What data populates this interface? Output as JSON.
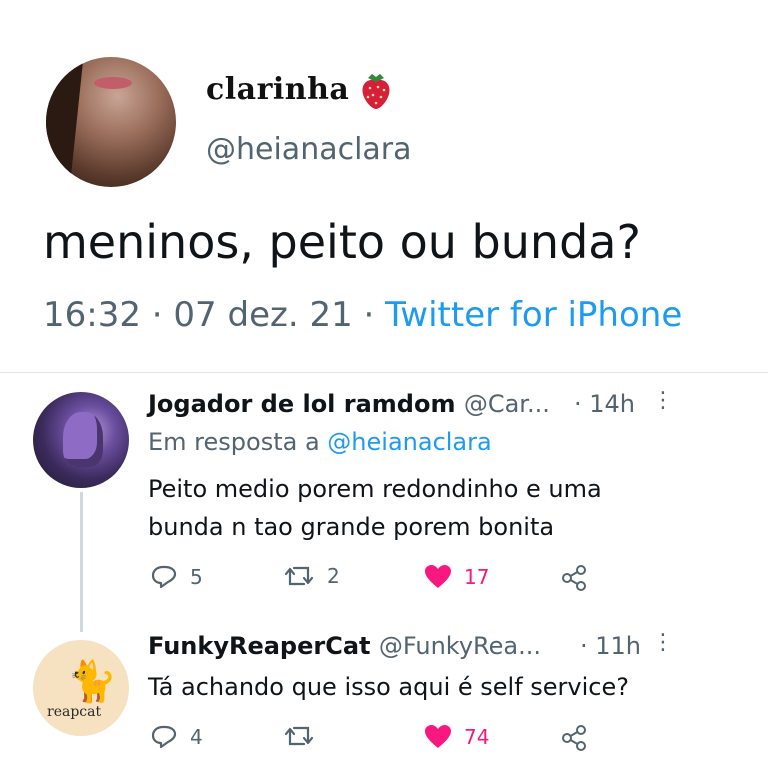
{
  "tweet": {
    "author": {
      "display_name": "clarinha",
      "emoji_icon": "strawberry-icon",
      "handle": "@heianaclara"
    },
    "text": "meninos, peito ou bunda?",
    "time": "16:32",
    "date": "07 dez. 21",
    "separator": "·",
    "source": "Twitter for iPhone"
  },
  "replies": [
    {
      "display_name": "Jogador de lol ramdom",
      "handle": "@Car...",
      "time": "· 14h",
      "reply_to_prefix": "Em resposta a",
      "reply_to_handle": "@heianaclara",
      "text_lines": [
        "Peito medio porem redondinho e uma",
        "bunda n tao grande porem bonita"
      ],
      "replies_count": "5",
      "retweets_count": "2",
      "likes_count": "17"
    },
    {
      "display_name": "FunkyReaperCat",
      "handle": "@FunkyRea...",
      "time": "· 11h",
      "text_lines": [
        "Tá achando que isso aqui é self service?"
      ],
      "avatar_label": "reapcat",
      "replies_count": "4",
      "retweets_count": "",
      "likes_count": "74"
    }
  ],
  "colors": {
    "link": "#1d9bf0",
    "like": "#f91880",
    "muted": "#536471"
  }
}
